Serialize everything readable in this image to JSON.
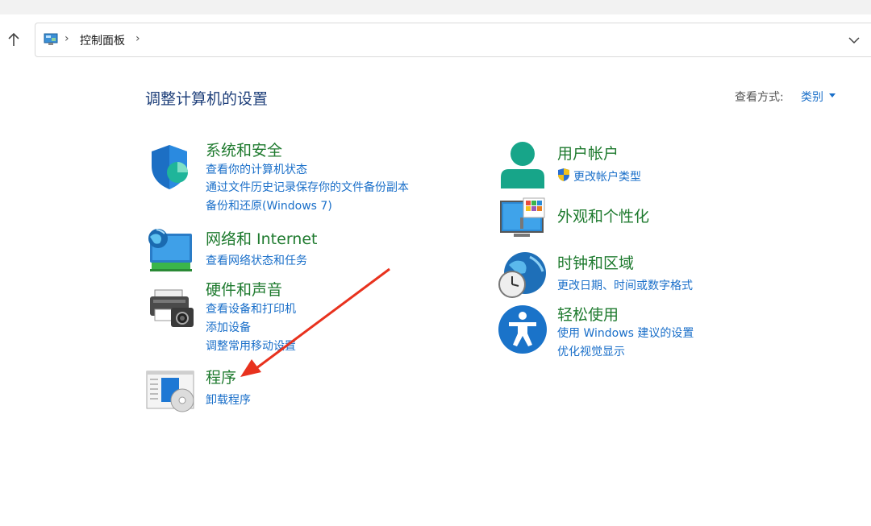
{
  "address": {
    "breadcrumb": "控制面板",
    "up_icon": "up-arrow-icon",
    "refresh_icon": "refresh-icon",
    "dropdown_icon": "chevron-down-icon"
  },
  "header": {
    "title": "调整计算机的设置",
    "view_by_label": "查看方式:",
    "view_by_value": "类别"
  },
  "categories": {
    "system": {
      "title": "系统和安全",
      "links": [
        "查看你的计算机状态",
        "通过文件历史记录保存你的文件备份副本",
        "备份和还原(Windows 7)"
      ]
    },
    "network": {
      "title": "网络和 Internet",
      "links": [
        "查看网络状态和任务"
      ]
    },
    "hardware": {
      "title": "硬件和声音",
      "links": [
        "查看设备和打印机",
        "添加设备",
        "调整常用移动设置"
      ]
    },
    "programs": {
      "title": "程序",
      "links": [
        "卸载程序"
      ]
    },
    "accounts": {
      "title": "用户帐户",
      "links": [
        "更改帐户类型"
      ]
    },
    "appearance": {
      "title": "外观和个性化",
      "links": []
    },
    "clock": {
      "title": "时钟和区域",
      "links": [
        "更改日期、时间或数字格式"
      ]
    },
    "ease": {
      "title": "轻松使用",
      "links": [
        "使用 Windows 建议的设置",
        "优化视觉显示"
      ]
    }
  },
  "colors": {
    "category_title": "#1e7a2e",
    "link": "#1a6fc9",
    "page_title": "#1e3f7a",
    "annotation_arrow": "#e8321e"
  }
}
